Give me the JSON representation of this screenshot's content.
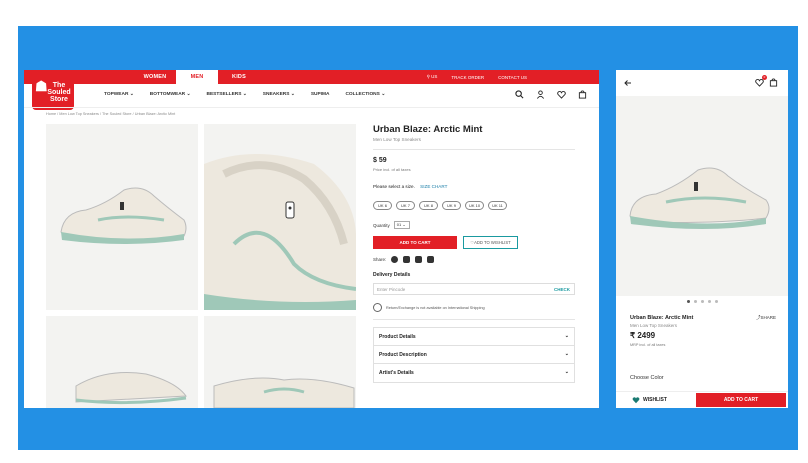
{
  "colors": {
    "brand_red": "#e21f26",
    "stage_blue": "#2390e4",
    "accent_teal": "#1a9aa0"
  },
  "topbar": {
    "tabs": [
      "WOMEN",
      "MEN",
      "KIDS"
    ],
    "active_tab": "MEN",
    "links": [
      "US",
      "TRACK ORDER",
      "CONTACT US"
    ]
  },
  "logo": {
    "text": "The Souled Store"
  },
  "nav": {
    "links": [
      "TOPWEAR",
      "BOTTOMWEAR",
      "BESTSELLERS",
      "SNEAKERS",
      "SUPIMA",
      "COLLECTIONS"
    ]
  },
  "breadcrumb": "Home / Men Low Top Sneakers / The Souled Store / Urban Blaze: Arctic Mint",
  "product": {
    "title": "Urban Blaze: Arctic Mint",
    "subtitle": "Men Low Top Sneakers",
    "price": "$ 59",
    "price_note": "Price incl. of all taxes",
    "size_prompt": "Please select a size.",
    "size_chart": "SIZE CHART",
    "sizes": [
      "UK 6",
      "UK 7",
      "UK 8",
      "UK 9",
      "UK 10",
      "UK 11"
    ],
    "quantity_label": "Quantity",
    "quantity_value": "01",
    "add_to_cart": "ADD TO CART",
    "add_to_wishlist": "ADD TO WISHLIST",
    "share_label": "Share:",
    "delivery_label": "Delivery Details",
    "pincode_placeholder": "Enter Pincode",
    "check_label": "CHECK",
    "return_note": "Return/Exchange is not available on International Shipping",
    "accordions": [
      "Product Details",
      "Product Description",
      "Artist's Details"
    ]
  },
  "mobile": {
    "title": "Urban Blaze: Arctic Mint",
    "share": "SHARE",
    "subtitle": "Men Low Top Sneakers",
    "price": "₹ 2499",
    "price_note": "MRP incl. of all taxes",
    "choose_color": "Choose Color",
    "wishlist": "WISHLIST",
    "add_to_cart": "ADD TO CART",
    "cart_badge": "0",
    "carousel_active": 1
  }
}
